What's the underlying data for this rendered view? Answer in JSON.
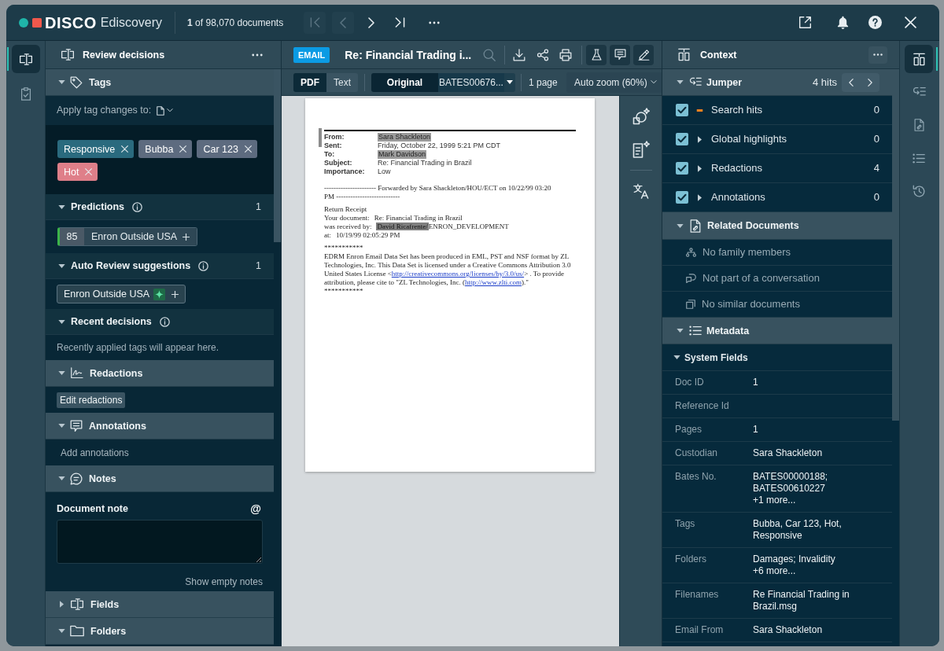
{
  "top_bar": {
    "brand": "DISCO",
    "product": "Ediscovery",
    "position": "**1** of 98,070 documents",
    "navigation": [
      {
        "kind": "first",
        "disabled": true
      },
      {
        "kind": "previous",
        "disabled": true
      },
      {
        "kind": "next",
        "disabled": false
      },
      {
        "kind": "last",
        "disabled": false
      }
    ]
  },
  "left_rail": [
    {
      "kind": "review",
      "selected": true
    },
    {
      "kind": "tasks",
      "selected": false
    }
  ],
  "review_panel": {
    "title": "Review decisions",
    "sections": [
      {
        "kind": "tags",
        "title": "Tags",
        "expanded": true,
        "apply_label": "Apply tag changes to:",
        "tags": [
          {
            "label": "Responsive",
            "color": "#2a6a7e"
          },
          {
            "label": "Bubba",
            "color": "#5d6b7f"
          },
          {
            "label": "Car 123",
            "color": "#5d6b7f"
          },
          {
            "label": "Hot",
            "color": "#df7f89"
          }
        ]
      },
      {
        "kind": "predictions",
        "title": "Predictions",
        "expanded": true,
        "count": "1",
        "predictions": [
          {
            "score": "85",
            "label": "Enron Outside USA"
          }
        ]
      },
      {
        "kind": "suggestions",
        "title": "Auto Review suggestions",
        "expanded": true,
        "count": "1",
        "suggestions": [
          {
            "label": "Enron Outside USA"
          }
        ]
      },
      {
        "kind": "recent",
        "title": "Recent decisions",
        "expanded": true,
        "message": "Recently applied tags will appear here."
      },
      {
        "kind": "redactions",
        "title": "Redactions",
        "expanded": true,
        "action": "Edit redactions"
      },
      {
        "kind": "annotations",
        "title": "Annotations",
        "expanded": true,
        "action": "Add annotations"
      },
      {
        "kind": "notes",
        "title": "Notes",
        "expanded": true,
        "note_label": "Document note",
        "mention": "@",
        "action": "Show empty notes"
      },
      {
        "kind": "fields",
        "title": "Fields",
        "expanded": false
      },
      {
        "kind": "folders",
        "title": "Folders",
        "expanded": true
      }
    ]
  },
  "document": {
    "type": "EMAIL",
    "title": "Re: Financial Trading i...",
    "view_modes": [
      {
        "label": "PDF",
        "selected": true
      },
      {
        "label": "Text",
        "selected": false
      }
    ],
    "versions": [
      {
        "label": "Original",
        "selected": true
      },
      {
        "label": "BATES00676...",
        "selected": false
      }
    ],
    "page_count": "1 page",
    "zoom": "Auto zoom (60%)",
    "page": {
      "header": [
        {
          "label": "From:",
          "value": "Sara Shackleton",
          "redacted": true
        },
        {
          "label": "Sent:",
          "value": "Friday, October 22, 1999 5:21 PM CDT",
          "redacted": false
        },
        {
          "label": "To:",
          "value": "Mark Davidson",
          "redacted": true
        },
        {
          "label": "Subject:",
          "value": "Re: Financial Trading in Brazil",
          "redacted": false
        },
        {
          "label": "Importance:",
          "value": "Low",
          "redacted": false
        }
      ],
      "blocks": [
        [
          {
            "kind": "line",
            "spans": [
              {
                "text": "---------------------- Forwarded by Sara Shackleton/HOU/ECT on 10/22/99 03:20",
                "redacted": false
              }
            ]
          },
          {
            "kind": "line",
            "spans": [
              {
                "text": "PM ---------------------------",
                "redacted": false
              }
            ]
          }
        ],
        [
          {
            "kind": "line",
            "spans": [
              {
                "text": "Return Receipt",
                "redacted": false
              }
            ]
          },
          {
            "kind": "line",
            "spans": [
              {
                "text": "Your document:",
                "redacted": false
              },
              {
                "text": "Re: Financial Trading in Brazil",
                "redacted": false
              }
            ]
          },
          {
            "kind": "line",
            "spans": [
              {
                "text": "was received by:",
                "redacted": false
              },
              {
                "text": "David Ricafrente/",
                "redacted": true
              },
              {
                "text": "ENRON_DEVELOPMENT",
                "redacted": false
              }
            ]
          },
          {
            "kind": "line",
            "spans": [
              {
                "text": "at:",
                "redacted": false
              },
              {
                "text": "10/19/99 02:05:29 PM",
                "redacted": false
              }
            ]
          }
        ],
        [
          {
            "kind": "line",
            "spans": [
              {
                "text": "***********",
                "redacted": false
              }
            ]
          },
          {
            "kind": "paragraph",
            "segments": [
              {
                "kind": "text",
                "text": "EDRM Enron Email Data Set has been produced in EML, PST and NSF format by ZL Technologies, Inc. This Data Set is licensed under a Creative Commons Attribution 3.0 United States License <"
              },
              {
                "kind": "link",
                "text": "http://creativecommons.org/licenses/by/3.0/us/"
              },
              {
                "kind": "text",
                "text": "> . To provide attribution, please cite to \"ZL Technologies, Inc. ("
              },
              {
                "kind": "link",
                "text": "http://www.zlti.com"
              },
              {
                "kind": "text",
                "text": ").\""
              }
            ]
          },
          {
            "kind": "line",
            "spans": [
              {
                "text": "***********",
                "redacted": false
              }
            ]
          }
        ]
      ]
    }
  },
  "context_panel": {
    "title": "Context",
    "jumper": {
      "title": "Jumper",
      "expanded": true,
      "hits": "4 hits",
      "rows": [
        {
          "kind": "search",
          "label": "Search hits",
          "checked": true,
          "count": "0"
        },
        {
          "kind": "group",
          "label": "Global highlights",
          "checked": true,
          "expanded": false,
          "count": "0"
        },
        {
          "kind": "group",
          "label": "Redactions",
          "checked": true,
          "expanded": false,
          "count": "4"
        },
        {
          "kind": "group",
          "label": "Annotations",
          "checked": true,
          "expanded": false,
          "count": "0"
        }
      ]
    },
    "related": {
      "title": "Related Documents",
      "expanded": true,
      "items": [
        {
          "kind": "family",
          "label": "No family members"
        },
        {
          "kind": "conversation",
          "label": "Not part of a conversation"
        },
        {
          "kind": "similar",
          "label": "No similar documents"
        }
      ]
    },
    "metadata": {
      "title": "Metadata",
      "expanded": true,
      "groups": [
        {
          "title": "System Fields",
          "expanded": true,
          "fields": [
            {
              "label": "Doc ID",
              "value": [
                "1"
              ]
            },
            {
              "label": "Reference Id"
            },
            {
              "label": "Pages",
              "value": [
                "1"
              ]
            },
            {
              "label": "Custodian",
              "value": [
                "Sara Shackleton"
              ]
            },
            {
              "label": "Bates No.",
              "value": [
                "BATES00000188;",
                "BATES00610227"
              ],
              "more": "+1 more..."
            },
            {
              "label": "Tags",
              "value": [
                "Bubba, Car 123, Hot, Responsive"
              ]
            },
            {
              "label": "Folders",
              "value": [
                "Damages; Invalidity"
              ],
              "more": "+6 more..."
            },
            {
              "label": "Filenames",
              "value": [
                "Re Financial Trading in Brazil.msg"
              ]
            },
            {
              "label": "Email From",
              "value": [
                "Sara Shackleton"
              ]
            }
          ]
        }
      ]
    }
  },
  "right_rail": [
    {
      "kind": "context",
      "selected": true
    },
    {
      "kind": "jumper",
      "selected": false
    },
    {
      "kind": "related",
      "selected": false
    },
    {
      "kind": "metadata",
      "selected": false
    },
    {
      "kind": "history",
      "selected": false
    }
  ]
}
